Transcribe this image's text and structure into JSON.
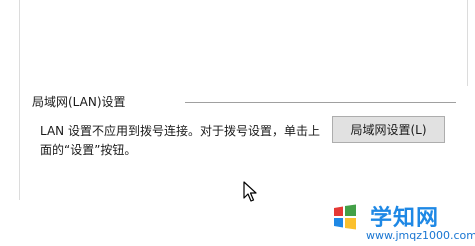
{
  "lan_section": {
    "group_title": "局域网(LAN)设置",
    "description": "LAN 设置不应用到拨号连接。对于拨号设置，单击上面的“设置”按钮。",
    "button_label": "局域网设置(L)"
  },
  "watermark": {
    "name": "学知网",
    "url": "www.jmqz1000.com",
    "logo_icon": "windows-logo-icon"
  },
  "cursor_icon": "mouse-pointer-icon"
}
